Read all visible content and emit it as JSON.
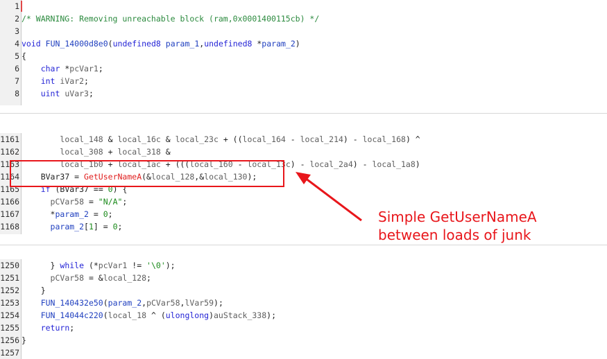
{
  "blocks": [
    {
      "lines": [
        {
          "n": "1",
          "segs": []
        },
        {
          "n": "2",
          "segs": [
            {
              "c": "t-comment",
              "t": "/* WARNING: Removing unreachable block (ram,0x0001400115cb) */"
            }
          ]
        },
        {
          "n": "3",
          "segs": []
        },
        {
          "n": "4",
          "segs": [
            {
              "c": "t-type",
              "t": "void"
            },
            {
              "c": "t-op",
              "t": " "
            },
            {
              "c": "t-fn",
              "t": "FUN_14000d8e0"
            },
            {
              "c": "t-op",
              "t": "("
            },
            {
              "c": "t-type",
              "t": "undefined8"
            },
            {
              "c": "t-op",
              "t": " "
            },
            {
              "c": "t-param",
              "t": "param_1"
            },
            {
              "c": "t-op",
              "t": ","
            },
            {
              "c": "t-type",
              "t": "undefined8"
            },
            {
              "c": "t-op",
              "t": " *"
            },
            {
              "c": "t-param",
              "t": "param_2"
            },
            {
              "c": "t-op",
              "t": ")"
            }
          ]
        },
        {
          "n": "5",
          "segs": [
            {
              "c": "t-op",
              "t": "{"
            }
          ]
        },
        {
          "n": "6",
          "segs": [
            {
              "c": "t-op",
              "t": "    "
            },
            {
              "c": "t-type",
              "t": "char"
            },
            {
              "c": "t-op",
              "t": " *"
            },
            {
              "c": "t-local",
              "t": "pcVar1"
            },
            {
              "c": "t-op",
              "t": ";"
            }
          ]
        },
        {
          "n": "7",
          "segs": [
            {
              "c": "t-op",
              "t": "    "
            },
            {
              "c": "t-type",
              "t": "int"
            },
            {
              "c": "t-op",
              "t": " "
            },
            {
              "c": "t-local",
              "t": "iVar2"
            },
            {
              "c": "t-op",
              "t": ";"
            }
          ]
        },
        {
          "n": "8",
          "segs": [
            {
              "c": "t-op",
              "t": "    "
            },
            {
              "c": "t-type",
              "t": "uint"
            },
            {
              "c": "t-op",
              "t": " "
            },
            {
              "c": "t-local",
              "t": "uVar3"
            },
            {
              "c": "t-op",
              "t": ";"
            }
          ]
        }
      ]
    },
    {
      "lines": [
        {
          "n": "1161",
          "segs": [
            {
              "c": "t-op",
              "t": "        "
            },
            {
              "c": "t-local",
              "t": "local_148"
            },
            {
              "c": "t-op",
              "t": " & "
            },
            {
              "c": "t-local",
              "t": "local_16c"
            },
            {
              "c": "t-op",
              "t": " & "
            },
            {
              "c": "t-local",
              "t": "local_23c"
            },
            {
              "c": "t-op",
              "t": " + (("
            },
            {
              "c": "t-local",
              "t": "local_164"
            },
            {
              "c": "t-op",
              "t": " - "
            },
            {
              "c": "t-local",
              "t": "local_214"
            },
            {
              "c": "t-op",
              "t": ") - "
            },
            {
              "c": "t-local",
              "t": "local_168"
            },
            {
              "c": "t-op",
              "t": ") ^"
            }
          ]
        },
        {
          "n": "1162",
          "segs": [
            {
              "c": "t-op",
              "t": "        "
            },
            {
              "c": "t-local",
              "t": "local_308"
            },
            {
              "c": "t-op",
              "t": " + "
            },
            {
              "c": "t-local",
              "t": "local_318"
            },
            {
              "c": "t-op",
              "t": " &"
            }
          ]
        },
        {
          "n": "1163",
          "segs": [
            {
              "c": "t-op",
              "t": "        "
            },
            {
              "c": "t-local",
              "t": "local_1b0"
            },
            {
              "c": "t-op",
              "t": " + "
            },
            {
              "c": "t-local",
              "t": "local_1ac"
            },
            {
              "c": "t-op",
              "t": " + ((("
            },
            {
              "c": "t-local",
              "t": "local_160"
            },
            {
              "c": "t-op",
              "t": " - "
            },
            {
              "c": "t-local",
              "t": "local_13c"
            },
            {
              "c": "t-op",
              "t": ") - "
            },
            {
              "c": "t-local",
              "t": "local_2a4"
            },
            {
              "c": "t-op",
              "t": ") - "
            },
            {
              "c": "t-local",
              "t": "local_1a8"
            },
            {
              "c": "t-op",
              "t": ")"
            }
          ]
        },
        {
          "n": "1164",
          "segs": [
            {
              "c": "t-op",
              "t": "    "
            },
            {
              "c": "t-glob",
              "t": "BVar37"
            },
            {
              "c": "t-op",
              "t": " = "
            },
            {
              "c": "t-call",
              "t": "GetUserNameA"
            },
            {
              "c": "t-op",
              "t": "(&"
            },
            {
              "c": "t-local",
              "t": "local_128"
            },
            {
              "c": "t-op",
              "t": ",&"
            },
            {
              "c": "t-local",
              "t": "local_130"
            },
            {
              "c": "t-op",
              "t": ");"
            }
          ]
        },
        {
          "n": "1165",
          "segs": [
            {
              "c": "t-op",
              "t": "    "
            },
            {
              "c": "t-kw",
              "t": "if"
            },
            {
              "c": "t-op",
              "t": " ("
            },
            {
              "c": "t-glob",
              "t": "BVar37"
            },
            {
              "c": "t-op",
              "t": " == "
            },
            {
              "c": "t-num",
              "t": "0"
            },
            {
              "c": "t-op",
              "t": ") {"
            }
          ]
        },
        {
          "n": "1166",
          "segs": [
            {
              "c": "t-op",
              "t": "      "
            },
            {
              "c": "t-local",
              "t": "pCVar58"
            },
            {
              "c": "t-op",
              "t": " = "
            },
            {
              "c": "t-str",
              "t": "\"N/A\""
            },
            {
              "c": "t-op",
              "t": ";"
            }
          ]
        },
        {
          "n": "1167",
          "segs": [
            {
              "c": "t-op",
              "t": "      *"
            },
            {
              "c": "t-param",
              "t": "param_2"
            },
            {
              "c": "t-op",
              "t": " = "
            },
            {
              "c": "t-num",
              "t": "0"
            },
            {
              "c": "t-op",
              "t": ";"
            }
          ]
        },
        {
          "n": "1168",
          "segs": [
            {
              "c": "t-op",
              "t": "      "
            },
            {
              "c": "t-param",
              "t": "param_2"
            },
            {
              "c": "t-op",
              "t": "["
            },
            {
              "c": "t-num",
              "t": "1"
            },
            {
              "c": "t-op",
              "t": "] = "
            },
            {
              "c": "t-num",
              "t": "0"
            },
            {
              "c": "t-op",
              "t": ";"
            }
          ]
        }
      ]
    },
    {
      "lines": [
        {
          "n": "1250",
          "segs": [
            {
              "c": "t-op",
              "t": "      } "
            },
            {
              "c": "t-kw",
              "t": "while"
            },
            {
              "c": "t-op",
              "t": " (*"
            },
            {
              "c": "t-local",
              "t": "pcVar1"
            },
            {
              "c": "t-op",
              "t": " != "
            },
            {
              "c": "t-str",
              "t": "'\\0'"
            },
            {
              "c": "t-op",
              "t": ");"
            }
          ]
        },
        {
          "n": "1251",
          "segs": [
            {
              "c": "t-op",
              "t": "      "
            },
            {
              "c": "t-local",
              "t": "pCVar58"
            },
            {
              "c": "t-op",
              "t": " = &"
            },
            {
              "c": "t-local",
              "t": "local_128"
            },
            {
              "c": "t-op",
              "t": ";"
            }
          ]
        },
        {
          "n": "1252",
          "segs": [
            {
              "c": "t-op",
              "t": "    }"
            }
          ]
        },
        {
          "n": "1253",
          "segs": [
            {
              "c": "t-op",
              "t": "    "
            },
            {
              "c": "t-fn",
              "t": "FUN_140432e50"
            },
            {
              "c": "t-op",
              "t": "("
            },
            {
              "c": "t-param",
              "t": "param_2"
            },
            {
              "c": "t-op",
              "t": ","
            },
            {
              "c": "t-local",
              "t": "pCVar58"
            },
            {
              "c": "t-op",
              "t": ","
            },
            {
              "c": "t-local",
              "t": "lVar59"
            },
            {
              "c": "t-op",
              "t": ");"
            }
          ]
        },
        {
          "n": "1254",
          "segs": [
            {
              "c": "t-op",
              "t": "    "
            },
            {
              "c": "t-fn",
              "t": "FUN_14044c220"
            },
            {
              "c": "t-op",
              "t": "("
            },
            {
              "c": "t-local",
              "t": "local_18"
            },
            {
              "c": "t-op",
              "t": " ^ ("
            },
            {
              "c": "t-type",
              "t": "ulonglong"
            },
            {
              "c": "t-op",
              "t": ")"
            },
            {
              "c": "t-local",
              "t": "auStack_338"
            },
            {
              "c": "t-op",
              "t": ");"
            }
          ]
        },
        {
          "n": "1255",
          "segs": [
            {
              "c": "t-op",
              "t": "    "
            },
            {
              "c": "t-kw",
              "t": "return"
            },
            {
              "c": "t-op",
              "t": ";"
            }
          ]
        },
        {
          "n": "1256",
          "segs": [
            {
              "c": "t-op",
              "t": "}"
            }
          ]
        },
        {
          "n": "1257",
          "segs": []
        }
      ]
    }
  ],
  "annotation": {
    "line1": "Simple GetUserNameA",
    "line2": "between loads of junk"
  },
  "colors": {
    "highlight": "#e8161b",
    "gutter": "#f1f1f1",
    "comment": "#2b8a3e",
    "keyword": "#2424d6",
    "api_call": "#e01e1e"
  }
}
